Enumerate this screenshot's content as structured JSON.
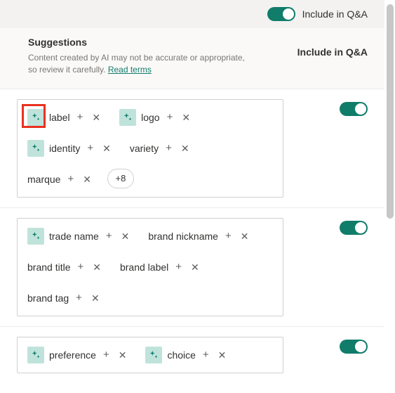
{
  "topBar": {
    "toggleLabel": "Include in Q&A",
    "toggleOn": true
  },
  "header": {
    "title": "Suggestions",
    "desc_a": "Content created by AI may not be accurate or appropriate, so review it carefully. ",
    "termsLink": "Read terms",
    "rightLabel": "Include in Q&A"
  },
  "groups": [
    {
      "highlightFirstIcon": true,
      "toggleOn": true,
      "chips": [
        {
          "ai": true,
          "text": "label"
        },
        {
          "ai": true,
          "text": "logo"
        },
        {
          "ai": true,
          "text": "identity"
        },
        {
          "ai": false,
          "text": "variety"
        },
        {
          "ai": false,
          "text": "marque"
        }
      ],
      "more": "+8"
    },
    {
      "highlightFirstIcon": false,
      "toggleOn": true,
      "chips": [
        {
          "ai": true,
          "text": "trade name"
        },
        {
          "ai": false,
          "text": "brand nickname"
        },
        {
          "ai": false,
          "text": "brand title"
        },
        {
          "ai": false,
          "text": "brand label"
        },
        {
          "ai": false,
          "text": "brand tag"
        }
      ],
      "more": null
    },
    {
      "highlightFirstIcon": false,
      "toggleOn": true,
      "chips": [
        {
          "ai": true,
          "text": "preference"
        },
        {
          "ai": true,
          "text": "choice"
        }
      ],
      "more": null
    }
  ],
  "glyphs": {
    "plus": "+",
    "x": "✕"
  }
}
